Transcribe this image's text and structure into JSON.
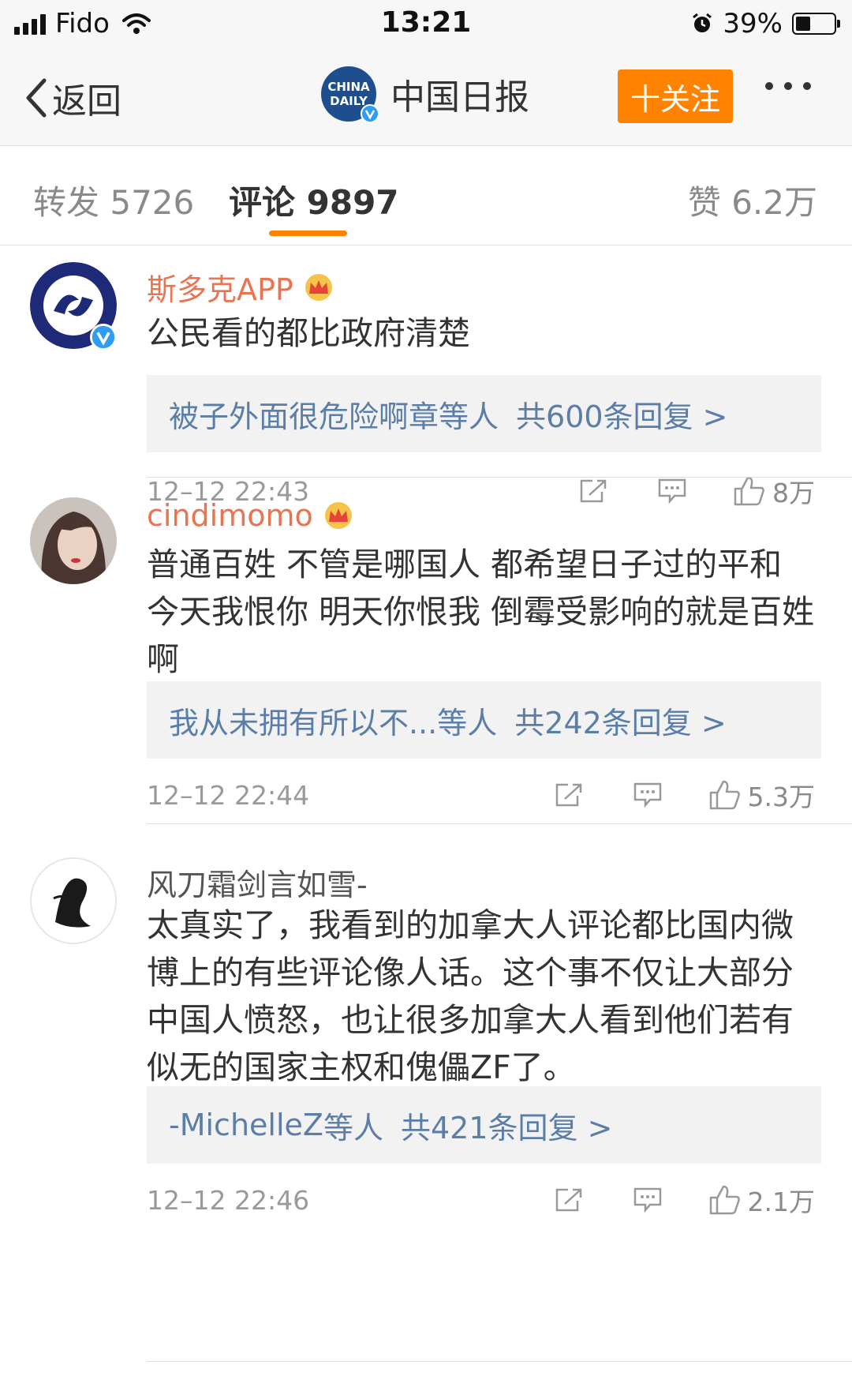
{
  "status_bar": {
    "carrier": "Fido",
    "time": "13:21",
    "battery": "39%"
  },
  "nav": {
    "back_label": "返回",
    "account_name": "中国日报",
    "logo_text_line1": "CHINA",
    "logo_text_line2": "DAILY",
    "follow_label": "十关注"
  },
  "tabs": [
    {
      "label": "转发 5726"
    },
    {
      "label": "评论 9897"
    },
    {
      "label": "赞 6.2万"
    }
  ],
  "comments": [
    {
      "username": "斯多克APP",
      "text": "公民看的都比政府清楚",
      "reply_users": "被子外面很危险啊章",
      "reply_etal": "等人",
      "reply_count": "共600条回复 >",
      "date": "12–12 22:43",
      "likes": "8万"
    },
    {
      "username": "cindimomo",
      "text": "普通百姓 不管是哪国人 都希望日子过的平和 今天我恨你 明天你恨我 倒霉受影响的就是百姓啊",
      "reply_users": "我从未拥有所以不...",
      "reply_etal": "等人",
      "reply_count": "共242条回复 >",
      "date": "12–12 22:44",
      "likes": "5.3万"
    },
    {
      "username": "风刀霜剑言如雪-",
      "text": "太真实了，我看到的加拿大人评论都比国内微博上的有些评论像人话。这个事不仅让大部分中国人愤怒，也让很多加拿大人看到他们若有似无的国家主权和傀儡ZF了。",
      "reply_users": "-MichelleZ",
      "reply_etal": "等人",
      "reply_count": "共421条回复 >",
      "date": "12–12 22:46",
      "likes": "2.1万"
    }
  ],
  "colors": {
    "accent": "#ff8200",
    "link": "#5b7ea8",
    "vip_name": "#eb7350"
  }
}
